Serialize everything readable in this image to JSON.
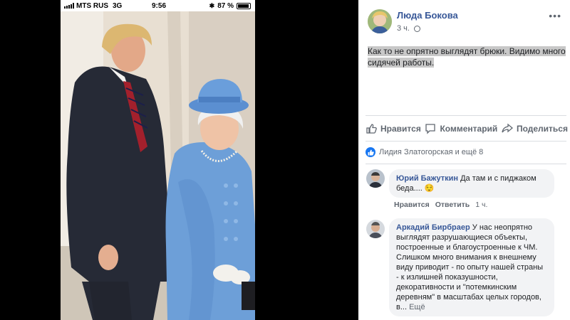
{
  "phone_status": {
    "carrier": "MTS RUS",
    "network": "3G",
    "time": "9:56",
    "battery": "87 %"
  },
  "post": {
    "author": "Люда Бокова",
    "time": "3 ч.",
    "text": "Как то не опрятно выглядят брюки. Видимо много сидячей работы.",
    "more_icon": "more-dots-icon"
  },
  "actions": {
    "like": "Нравится",
    "comment": "Комментарий",
    "share": "Поделиться"
  },
  "likes_summary": "Лидия Златогорская и ещё 8",
  "comments": [
    {
      "author": "Юрий Бажуткин",
      "text": "Да там и с пиджаком беда....",
      "emoji": "😌",
      "like": "Нравится",
      "reply": "Ответить",
      "time": "1 ч."
    },
    {
      "author": "Аркадий Бирбраер",
      "text": "У нас неопрятно выглядят разрушающиеся объекты, построенные и благоустроенные к ЧМ. Слишком много внимания к внешнему виду приводит - по опыту нашей страны - к излишней показушности, декоративности и \"потемкинским деревням\" в масштабах целых городов, в...",
      "see_more": "Ещё"
    }
  ],
  "colors": {
    "link_blue": "#385898",
    "fb_blue": "#1877f2",
    "gray_text": "#606770",
    "bubble_bg": "#f2f3f5"
  }
}
